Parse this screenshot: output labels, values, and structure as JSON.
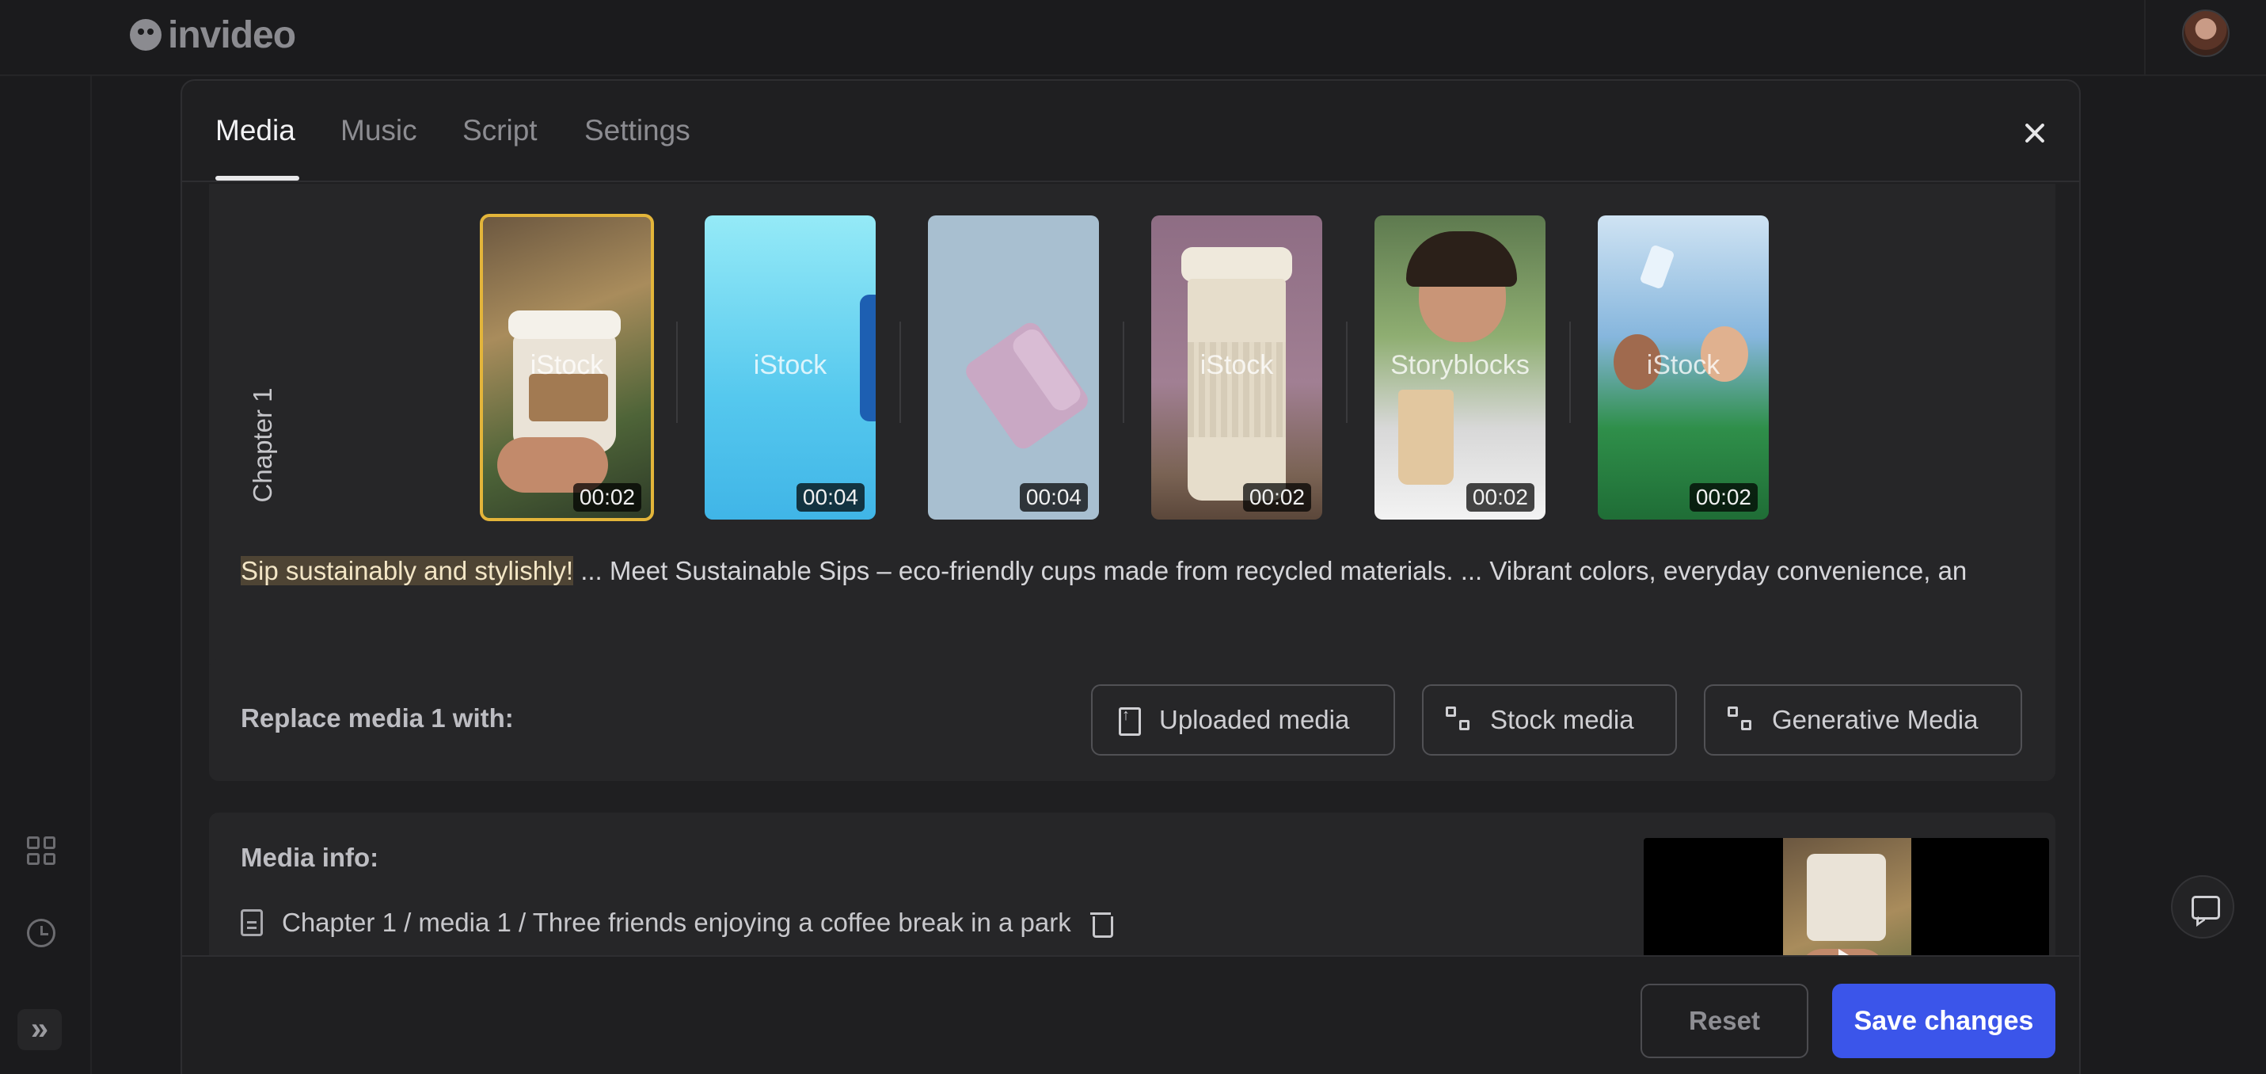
{
  "app": {
    "logo_text": "invideo"
  },
  "modal": {
    "tabs": [
      {
        "label": "Media",
        "active": true
      },
      {
        "label": "Music",
        "active": false
      },
      {
        "label": "Script",
        "active": false
      },
      {
        "label": "Settings",
        "active": false
      }
    ],
    "close_icon": "close-icon"
  },
  "chapter": {
    "label": "Chapter 1",
    "clips": [
      {
        "source": "iStock",
        "duration": "00:02",
        "selected": true
      },
      {
        "source": "iStock",
        "duration": "00:04",
        "selected": false
      },
      {
        "source": "",
        "duration": "00:04",
        "selected": false
      },
      {
        "source": "iStock",
        "duration": "00:02",
        "selected": false
      },
      {
        "source": "Storyblocks",
        "duration": "00:02",
        "selected": false
      },
      {
        "source": "iStock",
        "duration": "00:02",
        "selected": false
      }
    ],
    "script_highlight": "Sip sustainably and stylishly!",
    "script_rest": " ... Meet Sustainable Sips – eco-friendly cups made from recycled materials. ... Vibrant colors, everyday convenience, an"
  },
  "replace": {
    "label": "Replace media 1 with:",
    "uploaded": "Uploaded media",
    "stock": "Stock media",
    "generative": "Generative Media"
  },
  "info": {
    "label": "Media info:",
    "path": "Chapter 1 / media 1 / Three friends enjoying a coffee break in a park"
  },
  "footer": {
    "reset": "Reset",
    "save": "Save changes"
  },
  "colors": {
    "accent": "#3b55ea",
    "selected_outline": "#e3b53a",
    "highlight": "#4e4434"
  }
}
